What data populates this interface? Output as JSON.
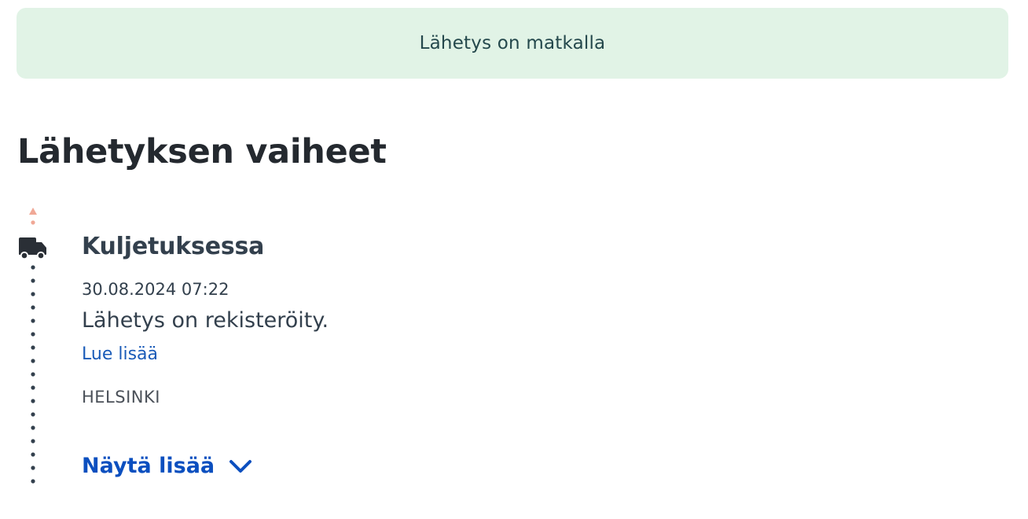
{
  "status_banner": {
    "text": "Lähetys on matkalla",
    "bg_color": "#e1f3e6"
  },
  "steps_section": {
    "title": "Lähetyksen vaiheet",
    "events": [
      {
        "title": "Kuljetuksessa",
        "icon": "truck-icon",
        "datetime": "30.08.2024 07:22",
        "description": "Lähetys on rekisteröity.",
        "link_label": "Lue lisää",
        "location": "HELSINKI"
      }
    ],
    "show_more_label": "Näytä lisää",
    "show_more_icon": "chevron-down-icon"
  },
  "colors": {
    "link": "#1a5bb8",
    "show_more": "#0b4fbf",
    "timeline_top_marker": "#f0a896",
    "timeline_dots": "#33404d"
  }
}
